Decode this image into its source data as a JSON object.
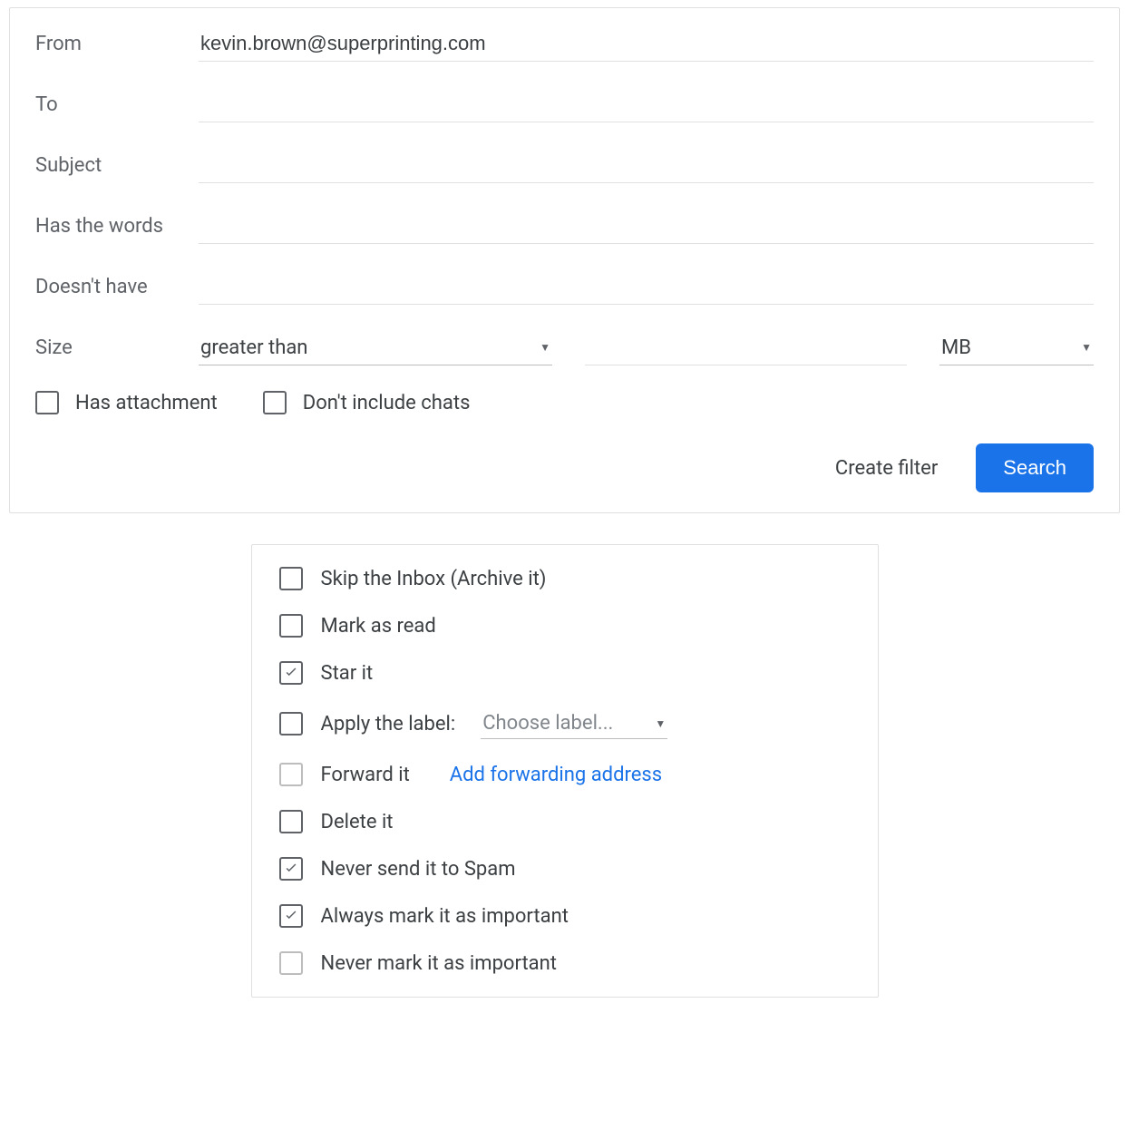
{
  "colors": {
    "primary": "#1a73e8"
  },
  "filterForm": {
    "fields": {
      "from": {
        "label": "From",
        "value": "kevin.brown@superprinting.com"
      },
      "to": {
        "label": "To",
        "value": ""
      },
      "subject": {
        "label": "Subject",
        "value": ""
      },
      "hasWords": {
        "label": "Has the words",
        "value": ""
      },
      "doesntHave": {
        "label": "Doesn't have",
        "value": ""
      }
    },
    "size": {
      "label": "Size",
      "comparator": "greater than",
      "amount": "",
      "unit": "MB"
    },
    "checkboxes": {
      "hasAttachment": {
        "label": "Has attachment",
        "checked": false
      },
      "dontIncludeChats": {
        "label": "Don't include chats",
        "checked": false
      }
    },
    "actions": {
      "createFilter": "Create filter",
      "search": "Search"
    }
  },
  "filterOptions": {
    "items": [
      {
        "label": "Skip the Inbox (Archive it)",
        "checked": false,
        "disabled": false
      },
      {
        "label": "Mark as read",
        "checked": false,
        "disabled": false
      },
      {
        "label": "Star it",
        "checked": true,
        "disabled": false
      },
      {
        "label": "Apply the label:",
        "checked": false,
        "disabled": false,
        "dropdown": {
          "placeholder": "Choose label..."
        }
      },
      {
        "label": "Forward it",
        "checked": false,
        "disabled": true,
        "link": "Add forwarding address"
      },
      {
        "label": "Delete it",
        "checked": false,
        "disabled": false
      },
      {
        "label": "Never send it to Spam",
        "checked": true,
        "disabled": false
      },
      {
        "label": "Always mark it as important",
        "checked": true,
        "disabled": false
      },
      {
        "label": "Never mark it as important",
        "checked": false,
        "disabled": true
      }
    ]
  }
}
